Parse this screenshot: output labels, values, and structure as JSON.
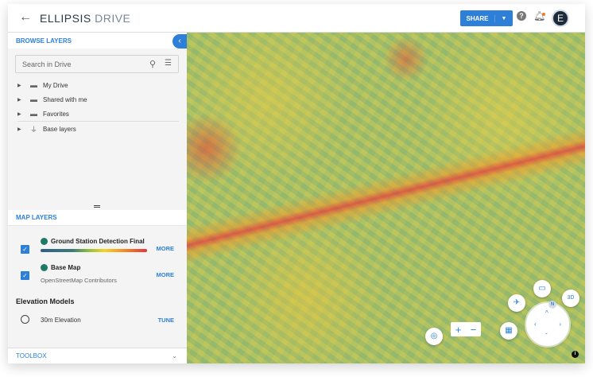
{
  "header": {
    "logo_main": "ELLIPSIS",
    "logo_sub": " DRIVE",
    "share_label": "SHARE",
    "avatar_letter": "E"
  },
  "browse": {
    "title": "BROWSE LAYERS",
    "search_placeholder": "Search in Drive",
    "items": [
      {
        "label": "My Drive"
      },
      {
        "label": "Shared with me"
      },
      {
        "label": "Favorites"
      },
      {
        "label": "Base layers"
      }
    ]
  },
  "map_layers": {
    "title": "MAP LAYERS",
    "layers": [
      {
        "name": "Ground Station Detection Final",
        "action": "MORE"
      },
      {
        "name": "Base Map",
        "subtitle": "OpenStreetMap Contributors",
        "action": "MORE"
      }
    ],
    "elevation_title": "Elevation Models",
    "elevation": [
      {
        "name": "30m Elevation",
        "action": "TUNE"
      }
    ]
  },
  "toolbox": {
    "title": "TOOLBOX"
  },
  "map": {
    "compass_label": "N",
    "three_d_label": "3D"
  },
  "colors": {
    "accent": "#2d7fd8",
    "brand_dark": "#1d2a3a"
  }
}
